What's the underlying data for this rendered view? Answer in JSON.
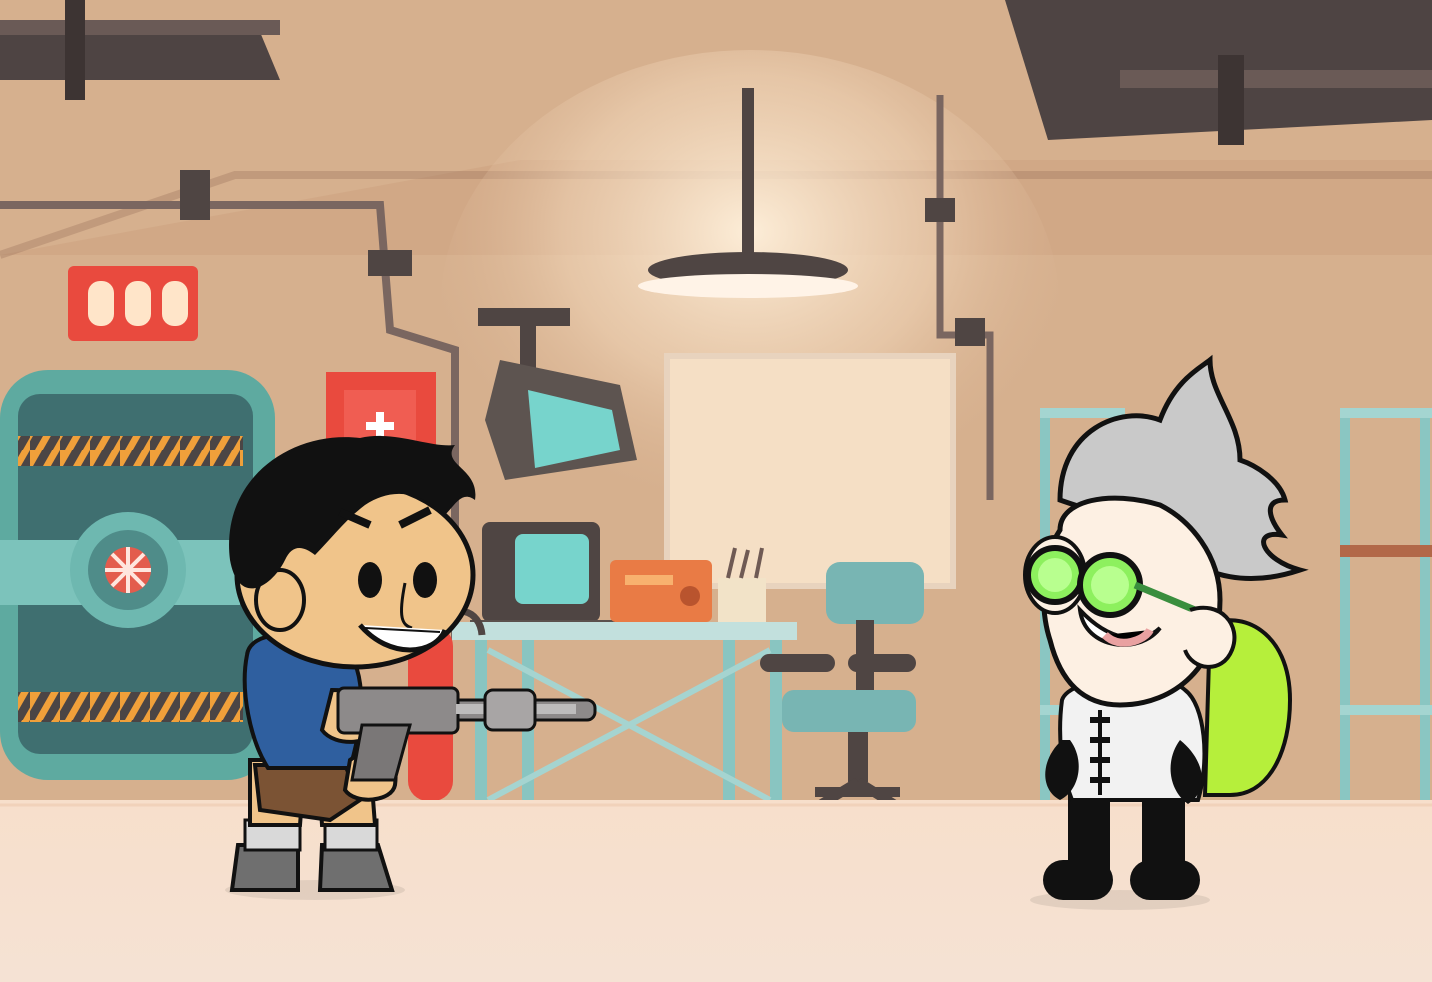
{
  "scene": {
    "name": "lab-basement",
    "colors": {
      "wall": "#d6b08e",
      "wall_dark": "#b88d6c",
      "floor": "#f1d7c2",
      "floor_light": "#fff1e6",
      "door_teal": "#5eaaa0",
      "door_dark": "#3f6f70",
      "hazard_orange": "#f0a03a",
      "hazard_dark": "#4b4545",
      "alarm_red": "#e94a3e",
      "monitor_teal": "#7fd3cc",
      "desk_teal": "#89c5c1",
      "chair_teal": "#78b5b3",
      "pipe_dark": "#4f4543",
      "hero_hair": "#111111",
      "hero_hoodie": "#2f5f9f",
      "hero_shorts": "#7b5334",
      "scientist_hair": "#c9c9c9",
      "goggles_green": "#8df05e",
      "backpack_green": "#b6ef3b",
      "scientist_coat": "#f2f2f2"
    },
    "objects": {
      "alarm_light": "alarm-light-icon",
      "vault_door": "vault-door",
      "fire_alarm_box": "fire-alarm-box",
      "fire_extinguisher": "fire-extinguisher",
      "security_camera": "security-camera-icon",
      "ceiling_lamp": "ceiling-lamp-icon",
      "monitor": "monitor-icon",
      "radio": "radio-icon",
      "desk": "lab-desk",
      "chair": "office-chair",
      "shelving": "metal-shelf",
      "whiteboard": "whiteboard"
    },
    "characters": {
      "hero": "hero-player",
      "scientist": "mad-scientist-enemy"
    }
  }
}
